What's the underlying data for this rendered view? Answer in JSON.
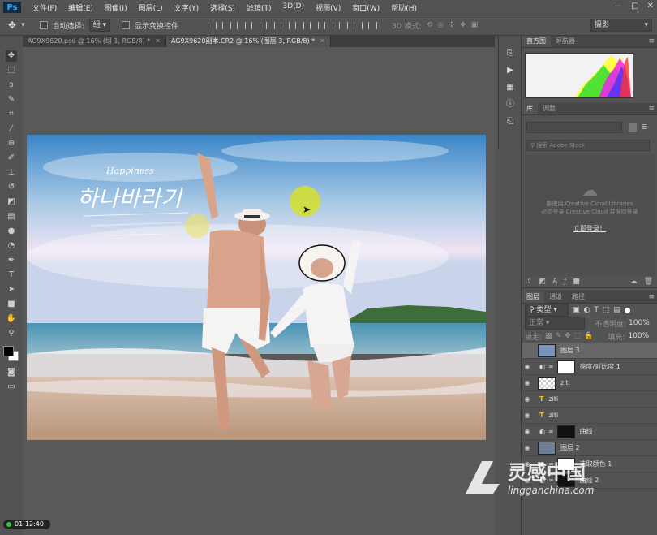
{
  "app": {
    "logo": "Ps"
  },
  "menu": [
    "文件(F)",
    "编辑(E)",
    "图像(I)",
    "图层(L)",
    "文字(Y)",
    "选择(S)",
    "滤镜(T)",
    "3D(D)",
    "视图(V)",
    "窗口(W)",
    "帮助(H)"
  ],
  "window_buttons": [
    "—",
    "▢",
    "✕"
  ],
  "options": {
    "auto_select_label": "自动选择:",
    "auto_select_value": "组",
    "show_transform_label": "显示变换控件",
    "mode_3d_label": "3D 模式:",
    "workspace": "摄影"
  },
  "tabs": [
    {
      "label": "AG9X9620.psd @ 16% (组 1, RGB/8) *",
      "active": false
    },
    {
      "label": "AG9X9620副本.CR2 @ 16% (图层 3, RGB/8) *",
      "active": true
    }
  ],
  "tools": [
    "move-tool",
    "marquee-tool",
    "lasso-tool",
    "quick-select-tool",
    "crop-tool",
    "eyedropper-tool",
    "healing-tool",
    "brush-tool",
    "clone-stamp-tool",
    "history-brush-tool",
    "eraser-tool",
    "gradient-tool",
    "blur-tool",
    "dodge-tool",
    "pen-tool",
    "type-tool",
    "path-select-tool",
    "shape-tool",
    "hand-tool",
    "zoom-tool"
  ],
  "photo": {
    "title_text": "Happiness",
    "script_text": "하나바라기"
  },
  "panels": {
    "histogram_tabs": [
      "直方图",
      "导航器"
    ],
    "library_tabs": [
      "库",
      "调整"
    ],
    "library_search": "搜索 Adobe Stock",
    "library_msg1": "要使用 Creative Cloud Libraries",
    "library_msg2": "必须登录 Creative Cloud 并保持登录",
    "library_login": "立即登录！",
    "layer_tabs": [
      "图层",
      "通道",
      "路径"
    ],
    "filter_label": "类型",
    "blend_mode": "正常",
    "opacity_label": "不透明度:",
    "opacity_value": "100%",
    "lock_label": "锁定:",
    "fill_label": "填充:",
    "fill_value": "100%"
  },
  "layers": [
    {
      "name": "图层 3",
      "type": "pixel",
      "selected": true,
      "visible": false
    },
    {
      "name": "亮度/对比度 1",
      "type": "adjustment",
      "selected": false,
      "visible": true
    },
    {
      "name": "ziti",
      "type": "pixel",
      "selected": false,
      "visible": true
    },
    {
      "name": "ziti",
      "type": "text",
      "selected": false,
      "visible": true
    },
    {
      "name": "ziti",
      "type": "text",
      "selected": false,
      "visible": true
    },
    {
      "name": "曲线",
      "type": "adjustment",
      "selected": false,
      "visible": true
    },
    {
      "name": "图层 2",
      "type": "pixel",
      "selected": false,
      "visible": true
    },
    {
      "name": "选取颜色 1",
      "type": "adjustment",
      "selected": false,
      "visible": true
    },
    {
      "name": "曲线 2",
      "type": "adjustment",
      "selected": false,
      "visible": true
    }
  ],
  "timer": "01:12:40",
  "watermark": {
    "brand": "灵感中国",
    "url": "lingganchina.com"
  }
}
